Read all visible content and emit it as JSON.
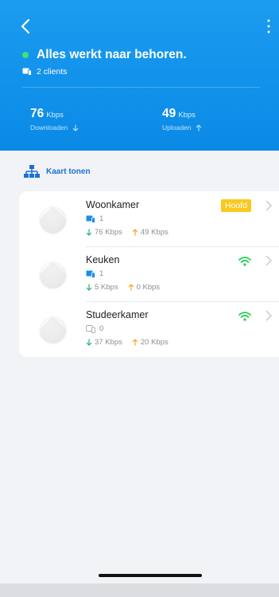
{
  "header": {
    "status": "Alles werkt naar behoren.",
    "clients": "2 clients",
    "download": {
      "value": "76",
      "unit": "Kbps",
      "label": "Downloaden"
    },
    "upload": {
      "value": "49",
      "unit": "Kbps",
      "label": "Uploaden"
    }
  },
  "map_link": "Kaart tonen",
  "nodes": [
    {
      "name": "Woonkamer",
      "clients": "1",
      "down": "76 Kbps",
      "up": "49 Kbps",
      "badge": "Hoofd"
    },
    {
      "name": "Keuken",
      "clients": "1",
      "down": "5 Kbps",
      "up": "0 Kbps"
    },
    {
      "name": "Studeerkamer",
      "clients": "0",
      "down": "37 Kbps",
      "up": "20 Kbps"
    }
  ],
  "colors": {
    "header": "#0a8ae6",
    "status_ok": "#3ee27a",
    "badge": "#fbc81f",
    "wifi": "#1fcf4e",
    "down_arrow": "#24b46a",
    "up_arrow": "#f5a623",
    "link": "#1a6fd8"
  },
  "icons": {
    "back": "chevron-left-icon",
    "more": "more-vertical-icon",
    "devices": "devices-icon",
    "map": "network-tree-icon",
    "wifi": "wifi-icon",
    "chevron": "chevron-right-icon"
  }
}
